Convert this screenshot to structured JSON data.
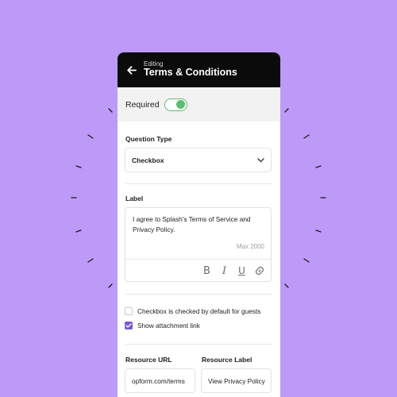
{
  "header": {
    "subtitle": "Editing",
    "title": "Terms & Conditions"
  },
  "required": {
    "label": "Required",
    "enabled": true
  },
  "question_type": {
    "label": "Question Type",
    "value": "Checkbox"
  },
  "label_field": {
    "label": "Label",
    "value": "I agree to Splash's Terms of Service and Privacy Policy.",
    "max": "Max 2000",
    "toolbar": [
      "bold-icon",
      "italic-icon",
      "underline-icon",
      "link-icon"
    ]
  },
  "options": [
    {
      "label": "Checkbox is checked by default for guests",
      "checked": false
    },
    {
      "label": "Show attachment link",
      "checked": true
    }
  ],
  "resource": {
    "url_label": "Resource URL",
    "url_value": "opform.com/terms",
    "name_label": "Resource Label",
    "name_value": "View Privacy Policy"
  },
  "colors": {
    "background": "#bd9af7",
    "header": "#0b0b0c",
    "toggle_green": "#5bbd71",
    "checkbox_purple": "#7b57d6"
  }
}
